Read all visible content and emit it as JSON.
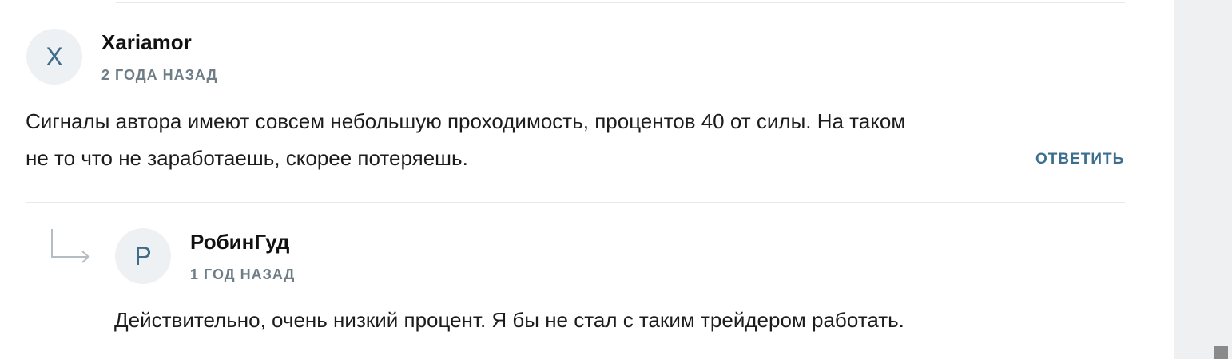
{
  "comments": [
    {
      "avatar_letter": "X",
      "author": "Xariamor",
      "timestamp": "2 ГОДА НАЗАД",
      "text_lines": [
        "Сигналы автора имеют совсем небольшую проходимость, процентов 40 от силы. На таком",
        "не то что не заработаешь, скорее потеряешь."
      ],
      "reply_label": "ОТВЕТИТЬ",
      "replies": [
        {
          "avatar_letter": "Р",
          "author": "РобинГуд",
          "timestamp": "1 ГОД НАЗАД",
          "text": "Действительно, очень низкий процент. Я бы не стал с таким трейдером работать."
        }
      ]
    }
  ],
  "icons": {
    "reply_indicator": "reply-arrow-icon"
  },
  "colors": {
    "avatar_bg": "#eef1f3",
    "avatar_letter": "#3f6c89",
    "timestamp": "#6f7d87",
    "reply_button": "#3c6f8f",
    "divider": "#e6e8ea",
    "gutter": "#eef0f2"
  }
}
